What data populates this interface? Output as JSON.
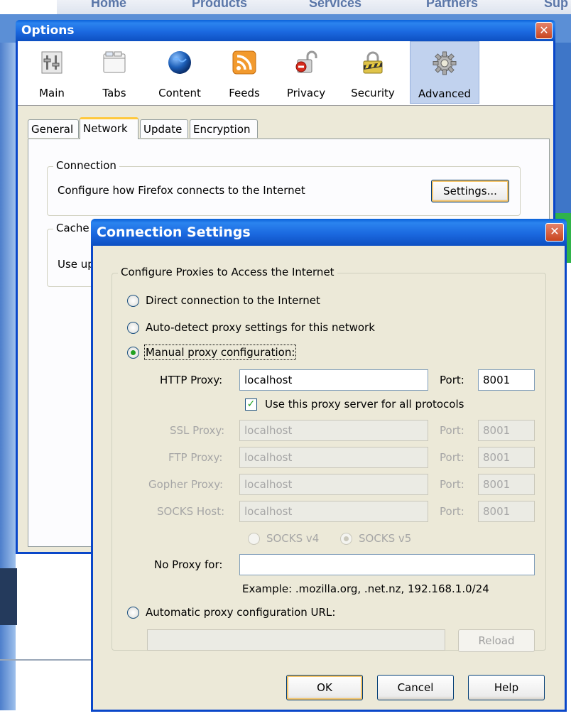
{
  "background": {
    "nav": [
      "Home",
      "Products",
      "Services",
      "Partners",
      "Sup"
    ]
  },
  "options": {
    "title": "Options",
    "toolbar": [
      {
        "label": "Main",
        "icon": "main-icon"
      },
      {
        "label": "Tabs",
        "icon": "tabs-icon"
      },
      {
        "label": "Content",
        "icon": "globe-icon"
      },
      {
        "label": "Feeds",
        "icon": "rss-icon"
      },
      {
        "label": "Privacy",
        "icon": "privacy-lock-icon"
      },
      {
        "label": "Security",
        "icon": "security-padlock-icon"
      },
      {
        "label": "Advanced",
        "icon": "gear-icon"
      }
    ],
    "tabs": [
      "General",
      "Network",
      "Update",
      "Encryption"
    ],
    "active_tab": "Network",
    "connection": {
      "legend": "Connection",
      "description": "Configure how Firefox connects to the Internet",
      "settings_button": "Settings..."
    },
    "cache": {
      "legend": "Cache",
      "text": "Use up"
    }
  },
  "connection_settings": {
    "title": "Connection Settings",
    "group_legend": "Configure Proxies to Access the Internet",
    "options": {
      "direct": "Direct connection to the Internet",
      "auto_detect": "Auto-detect proxy settings for this network",
      "manual": "Manual proxy configuration:",
      "auto_url": "Automatic proxy configuration URL:"
    },
    "selected": "manual",
    "http_proxy": {
      "label": "HTTP Proxy:",
      "value": "localhost",
      "port_label": "Port:",
      "port": "8001"
    },
    "use_for_all": {
      "label": "Use this proxy server for all protocols",
      "checked": true
    },
    "ssl_proxy": {
      "label": "SSL Proxy:",
      "value": "localhost",
      "port_label": "Port:",
      "port": "8001"
    },
    "ftp_proxy": {
      "label": "FTP Proxy:",
      "value": "localhost",
      "port_label": "Port:",
      "port": "8001"
    },
    "gopher_proxy": {
      "label": "Gopher Proxy:",
      "value": "localhost",
      "port_label": "Port:",
      "port": "8001"
    },
    "socks_host": {
      "label": "SOCKS Host:",
      "value": "localhost",
      "port_label": "Port:",
      "port": "8001"
    },
    "socks_v4": "SOCKS v4",
    "socks_v5": "SOCKS v5",
    "socks_selected": "v5",
    "no_proxy": {
      "label": "No Proxy for:",
      "value": ""
    },
    "example": "Example: .mozilla.org, .net.nz, 192.168.1.0/24",
    "auto_url_value": "",
    "reload_button": "Reload",
    "ok_button": "OK",
    "cancel_button": "Cancel",
    "help_button": "Help"
  }
}
